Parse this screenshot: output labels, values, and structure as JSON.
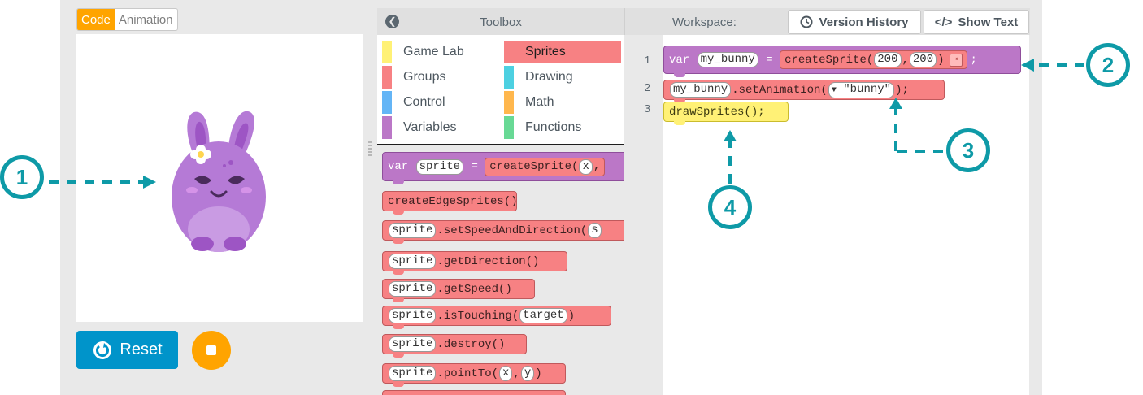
{
  "mode_toggle": {
    "code": "Code",
    "animation": "Animation"
  },
  "controls": {
    "reset": "Reset"
  },
  "toolbox": {
    "title": "Toolbox",
    "categories": [
      {
        "label": "Game Lab",
        "color": "#fff176"
      },
      {
        "label": "Sprites",
        "color": "#f78183"
      },
      {
        "label": "Groups",
        "color": "#f78183"
      },
      {
        "label": "Drawing",
        "color": "#4dd0e1"
      },
      {
        "label": "Control",
        "color": "#64b5f6"
      },
      {
        "label": "Math",
        "color": "#ffb74d"
      },
      {
        "label": "Variables",
        "color": "#bb77c7"
      },
      {
        "label": "Functions",
        "color": "#68d995"
      }
    ],
    "blocks": {
      "var_kw": "var",
      "var_name": "sprite",
      "eq": "=",
      "create_fn": "createSprite(",
      "create_arg": "x",
      "create_tail": ",",
      "edge": "createEdgeSprites()",
      "sprite": "sprite",
      "set_speed": ".setSpeedAndDirection(",
      "set_speed_arg": "s",
      "get_dir": ".getDirection()",
      "get_speed": ".getSpeed()",
      "is_touching": ".isTouching(",
      "is_touching_arg": "target",
      "close": ")",
      "destroy": ".destroy()",
      "point_to": ".pointTo(",
      "point_x": "x",
      "comma": ", ",
      "point_y": "y"
    }
  },
  "workspace": {
    "title": "Workspace:",
    "version_history": "Version History",
    "show_text": "Show Text",
    "line_numbers": [
      "1",
      "2",
      "3"
    ],
    "line1": {
      "kw": "var",
      "name": "my_bunny",
      "eq": "=",
      "fn": "createSprite(",
      "a1": "200",
      "comma": ", ",
      "a2": "200",
      "close": ")",
      "end": ";"
    },
    "line2": {
      "obj": "my_bunny",
      "method": ".setAnimation(",
      "dropdown": "▼",
      "value": "\"bunny\"",
      "end": ");"
    },
    "line3": {
      "code": "drawSprites();"
    }
  },
  "callouts": [
    "1",
    "2",
    "3",
    "4"
  ],
  "accent": "#0e9aa7"
}
